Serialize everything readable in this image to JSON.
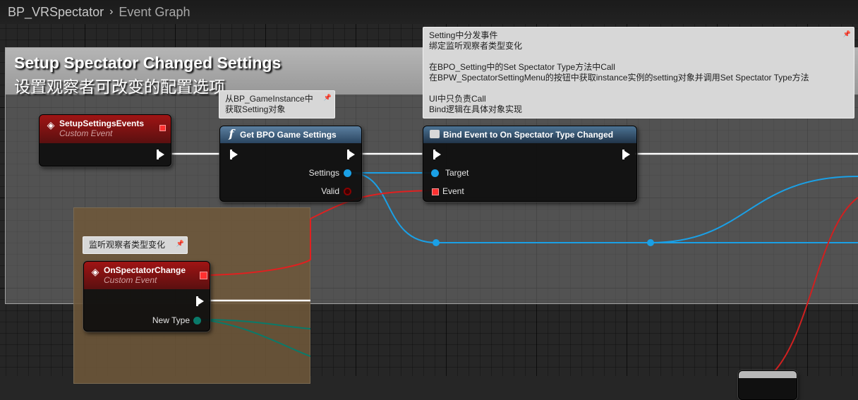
{
  "breadcrumb": {
    "blueprint": "BP_VRSpectator",
    "separator": "›",
    "graph": "Event Graph"
  },
  "comment_box": {
    "title_en": "Setup Spectator Changed Settings",
    "title_zh": "设置观察者可改变的配置选项"
  },
  "notes": {
    "top_right_lines": [
      "Setting中分发事件",
      "绑定监听观察者类型变化",
      "",
      "在BPO_Setting中的Set Spectator Type方法中Call",
      "在BPW_SpectatorSettingMenu的按钮中获取instance实例的setting对象并调用Set Spectator Type方法",
      "",
      "UI中只负责Call",
      "Bind逻辑在具体对象实现"
    ],
    "get_settings_note_lines": [
      "从BP_GameInstance中",
      "获取Setting对象"
    ],
    "listen_note": "监听观察者类型变化"
  },
  "nodes": {
    "setup_event": {
      "title": "SetupSettingsEvents",
      "subtitle": "Custom Event"
    },
    "get_settings": {
      "title": "Get BPO Game Settings",
      "icon_label": "f",
      "out_settings": "Settings",
      "out_valid": "Valid"
    },
    "bind_event": {
      "title": "Bind Event to On Spectator Type Changed",
      "in_target": "Target",
      "in_event": "Event"
    },
    "spectator_change": {
      "title": "OnSpectatorChange",
      "subtitle": "Custom Event",
      "out_new_type": "New Type"
    }
  },
  "colors": {
    "exec_wire": "#ffffff",
    "object_wire": "#1aa0e6",
    "delegate_wire": "#e02020",
    "byte_wire": "#0a7a6a",
    "comment_brown": "#6e583a"
  },
  "icons": {
    "event": "diamond-event-icon",
    "function": "function-f-icon",
    "bind": "bind-event-icon",
    "pin": "pin-icon"
  }
}
